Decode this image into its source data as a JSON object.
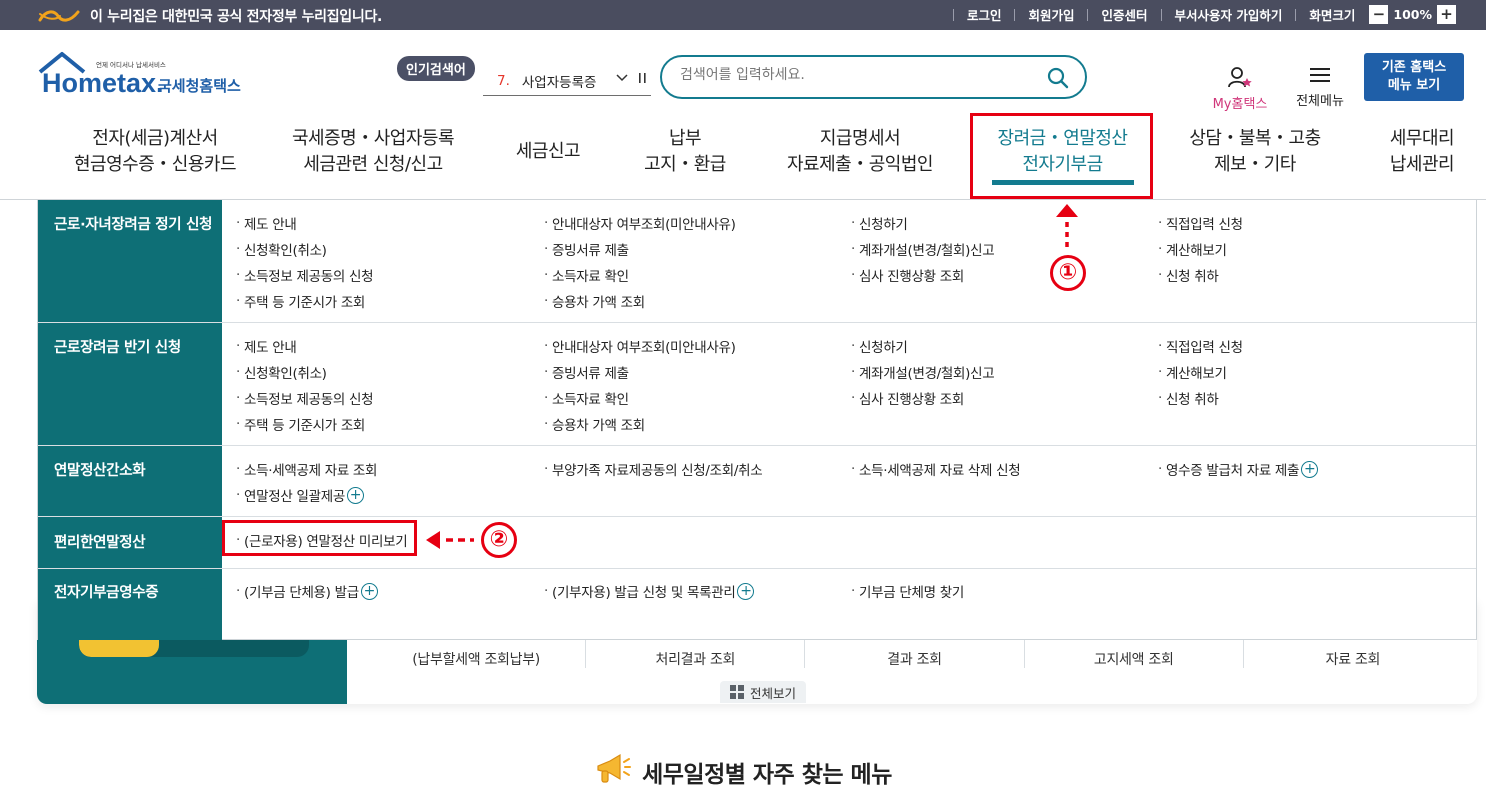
{
  "gov_banner": {
    "text": "이 누리집은 대한민국 공식 전자정부 누리집입니다.",
    "links": [
      "로그인",
      "회원가입",
      "인증센터",
      "부서사용자 가입하기"
    ],
    "zoom_label": "화면크기",
    "zoom_minus": "−",
    "zoom_value": "100%",
    "zoom_plus": "+"
  },
  "header": {
    "logo_tagline": "언제 어디서나 납세서비스",
    "logo_text": "Hometax.",
    "logo_korean": "국세청홈택스",
    "popular_badge": "인기검색어",
    "popular_rank": "7.",
    "popular_term": "사업자등록증",
    "search_placeholder": "검색어를 입력하세요.",
    "my_hometax": "My홈택스",
    "all_menu": "전체메뉴",
    "old_home_line1": "기존 홈택스",
    "old_home_line2": "메뉴 보기"
  },
  "gnb": [
    {
      "line1": "전자(세금)계산서",
      "line2": "현금영수증・신용카드"
    },
    {
      "line1": "국세증명・사업자등록",
      "line2": "세금관련 신청/신고"
    },
    {
      "line1": "세금신고",
      "line2": ""
    },
    {
      "line1": "납부",
      "line2": "고지・환급"
    },
    {
      "line1": "지급명세서",
      "line2": "자료제출・공익법인"
    },
    {
      "line1": "장려금・연말정산",
      "line2": "전자기부금"
    },
    {
      "line1": "상담・불복・고충",
      "line2": "제보・기타"
    },
    {
      "line1": "세무대리",
      "line2": "납세관리"
    }
  ],
  "mega": {
    "rows": [
      {
        "category": "근로·자녀장려금 정기 신청",
        "cols": [
          [
            "제도 안내",
            "신청확인(취소)",
            "소득정보 제공동의 신청",
            "주택 등 기준시가 조회"
          ],
          [
            "안내대상자 여부조회(미안내사유)",
            "증빙서류 제출",
            "소득자료 확인",
            "승용차 가액 조회"
          ],
          [
            "신청하기",
            "계좌개설(변경/철회)신고",
            "심사 진행상황 조회"
          ],
          [
            "직접입력 신청",
            "계산해보기",
            "신청 취하"
          ]
        ]
      },
      {
        "category": "근로장려금 반기 신청",
        "cols": [
          [
            "제도 안내",
            "신청확인(취소)",
            "소득정보 제공동의 신청",
            "주택 등 기준시가 조회"
          ],
          [
            "안내대상자 여부조회(미안내사유)",
            "증빙서류 제출",
            "소득자료 확인",
            "승용차 가액 조회"
          ],
          [
            "신청하기",
            "계좌개설(변경/철회)신고",
            "심사 진행상황 조회"
          ],
          [
            "직접입력 신청",
            "계산해보기",
            "신청 취하"
          ]
        ]
      },
      {
        "category": "연말정산간소화",
        "cols": [
          [
            "소득·세액공제 자료 조회",
            "연말정산 일괄제공"
          ],
          [
            "부양가족 자료제공동의 신청/조회/취소"
          ],
          [
            "소득·세액공제 자료 삭제 신청"
          ],
          [
            "영수증 발급처 자료 제출"
          ]
        ]
      },
      {
        "category": "편리한연말정산",
        "cols": [
          [
            "(근로자용) 연말정산 미리보기"
          ]
        ]
      },
      {
        "category": "전자기부금영수증",
        "cols": [
          [
            "(기부금 단체용) 발급"
          ],
          [
            "(기부자용) 발급 신청 및 목록관리"
          ],
          [
            "기부금 단체명 찾기"
          ]
        ]
      }
    ],
    "plus_symbol": "+",
    "dot": "·"
  },
  "annotations": {
    "marker1": "①",
    "marker2": "②",
    "highlight_color": "#e60012"
  },
  "behind": {
    "tabs": [
      "(납부할세액 조회납부)",
      "처리결과 조회",
      "결과 조회",
      "고지세액 조회",
      "자료 조회"
    ],
    "view_all": "전체보기"
  },
  "section": {
    "title": "세무일정별 자주 찾는 메뉴"
  },
  "colors": {
    "teal": "#0e6f76",
    "accent": "#137b8f",
    "gov_bar": "#4a4d5f",
    "old_home_btn": "#1f5fa8",
    "popular_rank": "#e5372c",
    "my_hometax": "#d0367a"
  }
}
